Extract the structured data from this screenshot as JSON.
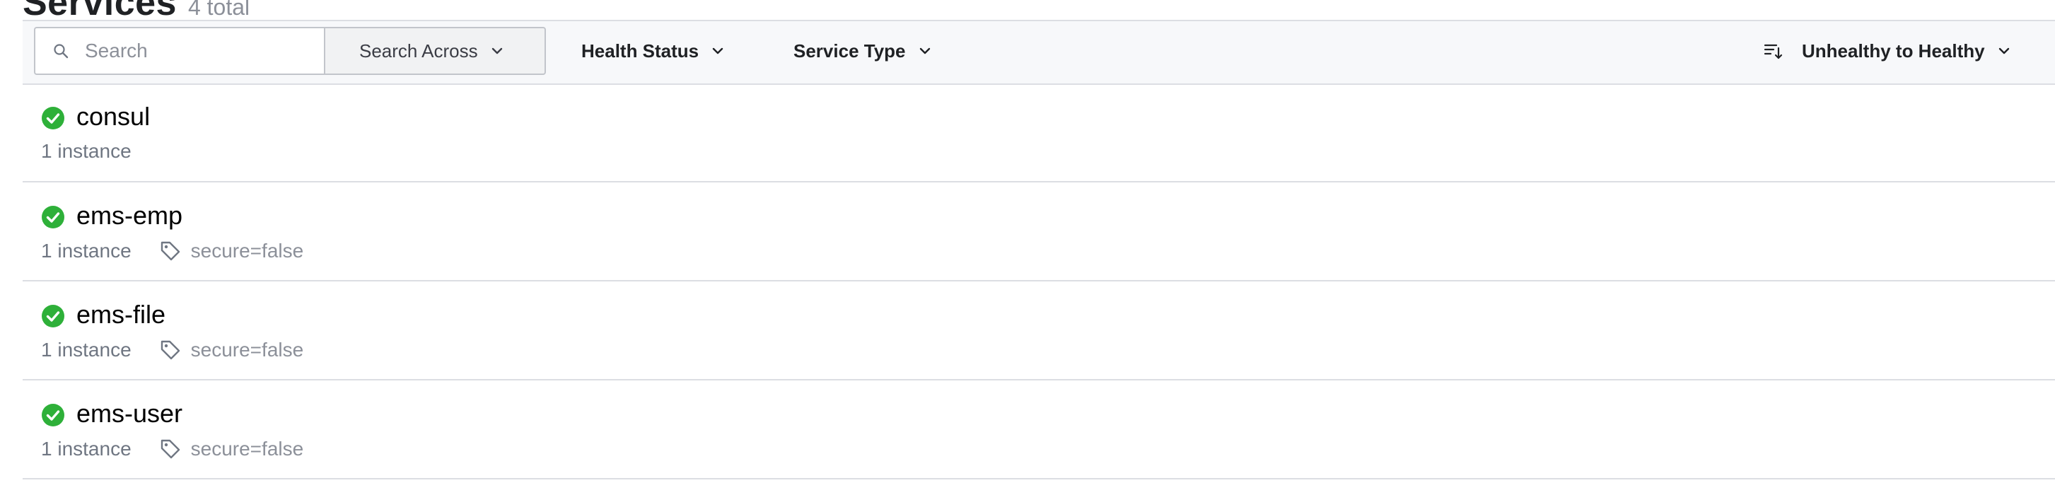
{
  "header": {
    "title": "Services",
    "count": "4 total"
  },
  "filter_bar": {
    "search": {
      "placeholder": "Search",
      "value": "",
      "icon": "search-icon"
    },
    "search_across_label": "Search Across",
    "health_status_label": "Health Status",
    "service_type_label": "Service Type",
    "sort_label": "Unhealthy to Healthy"
  },
  "services": [
    {
      "name": "consul",
      "instances": "1 instance",
      "tag": "",
      "status": "passing"
    },
    {
      "name": "ems-emp",
      "instances": "1 instance",
      "tag": "secure=false",
      "status": "passing"
    },
    {
      "name": "ems-file",
      "instances": "1 instance",
      "tag": "secure=false",
      "status": "passing"
    },
    {
      "name": "ems-user",
      "instances": "1 instance",
      "tag": "secure=false",
      "status": "passing"
    }
  ],
  "colors": {
    "status_passing": "#2eb039",
    "text_primary": "#1f2124",
    "text_muted": "#6f7682",
    "border": "#dcdee3",
    "filter_bg": "#f7f8fa"
  }
}
